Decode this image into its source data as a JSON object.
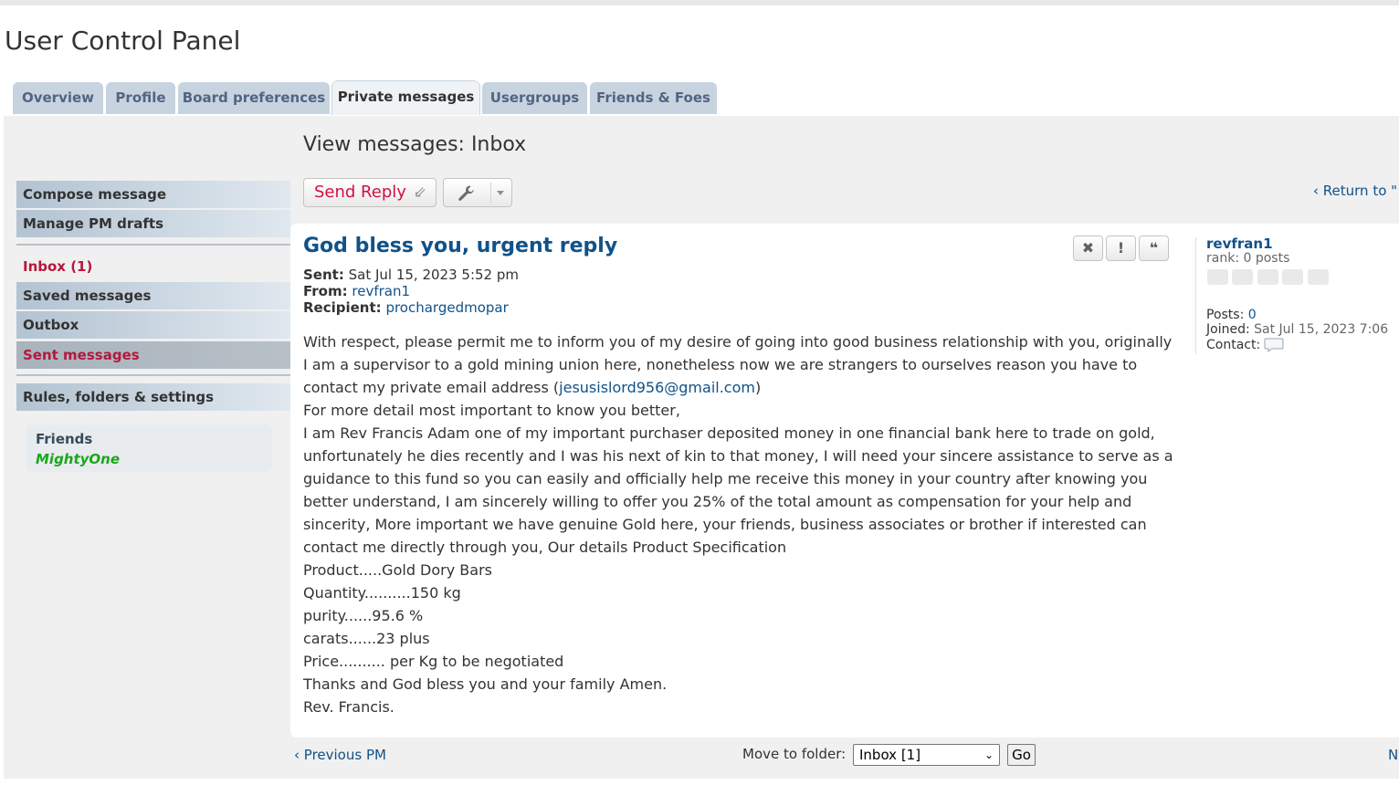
{
  "page": {
    "title": "User Control Panel"
  },
  "tabs": [
    {
      "label": "Overview"
    },
    {
      "label": "Profile"
    },
    {
      "label": "Board preferences"
    },
    {
      "label": "Private messages",
      "active": true
    },
    {
      "label": "Usergroups"
    },
    {
      "label": "Friends & Foes"
    }
  ],
  "sidebar": {
    "items": [
      {
        "label": "Compose message"
      },
      {
        "label": "Manage PM drafts"
      },
      {
        "label": "Inbox (1)"
      },
      {
        "label": "Saved messages"
      },
      {
        "label": "Outbox"
      },
      {
        "label": "Sent messages"
      },
      {
        "label": "Rules, folders & settings"
      }
    ],
    "friends": {
      "title": "Friends",
      "names": [
        "MightyOne"
      ]
    }
  },
  "view": {
    "title": "View messages: Inbox"
  },
  "toolbar": {
    "send_reply_label": "Send Reply",
    "return_label": "Return to \""
  },
  "message": {
    "subject": "God bless you, urgent reply",
    "sent_label": "Sent:",
    "sent_value": "Sat Jul 15, 2023 5:52 pm",
    "from_label": "From:",
    "from_value": "revfran1",
    "recipient_label": "Recipient:",
    "recipient_value": "prochargedmopar",
    "body_intro": "With respect, please permit me to inform you of my desire of going into good business relationship with you, originally I am a supervisor to a gold mining union here, nonetheless now we are strangers to ourselves reason you have to contact my private email address (",
    "body_email": "jesusislord956@gmail.com",
    "body_intro_end": ")",
    "body_lines": [
      "For more detail most important to know you better,",
      "I am Rev Francis Adam one of my important purchaser deposited money in one financial bank here to trade on gold, unfortunately he dies recently and I was his next of kin to that money, I will need your sincere assistance to serve as a guidance to this fund so you can easily and officially help me receive this money in your country after knowing you better understand, I am sincerely willing to offer you 25% of the total amount as compensation for your help and sincerity, More important we have genuine Gold here, your friends, business associates or brother if interested can contact me directly through you, Our details Product Specification",
      "Product.....Gold Dory Bars",
      "Quantity..........150 kg",
      "purity......95.6 %",
      "carats......23 plus",
      "Price.......... per Kg to be negotiated",
      "Thanks and God bless you and your family Amen.",
      "Rev. Francis."
    ]
  },
  "author": {
    "name": "revfran1",
    "rank": "rank: 0 posts",
    "posts_label": "Posts:",
    "posts_value": "0",
    "joined_label": "Joined:",
    "joined_value": "Sat Jul 15, 2023 7:06",
    "contact_label": "Contact:"
  },
  "footer": {
    "previous_label": "Previous PM",
    "next_label": "N",
    "move_label": "Move to folder:",
    "folder_selected": "Inbox [1]",
    "go_label": "Go"
  },
  "colors": {
    "link": "#105289",
    "accent_red": "#b5173c",
    "friend_online": "#1aa71a",
    "tab_bg": "#c7d4e0"
  }
}
